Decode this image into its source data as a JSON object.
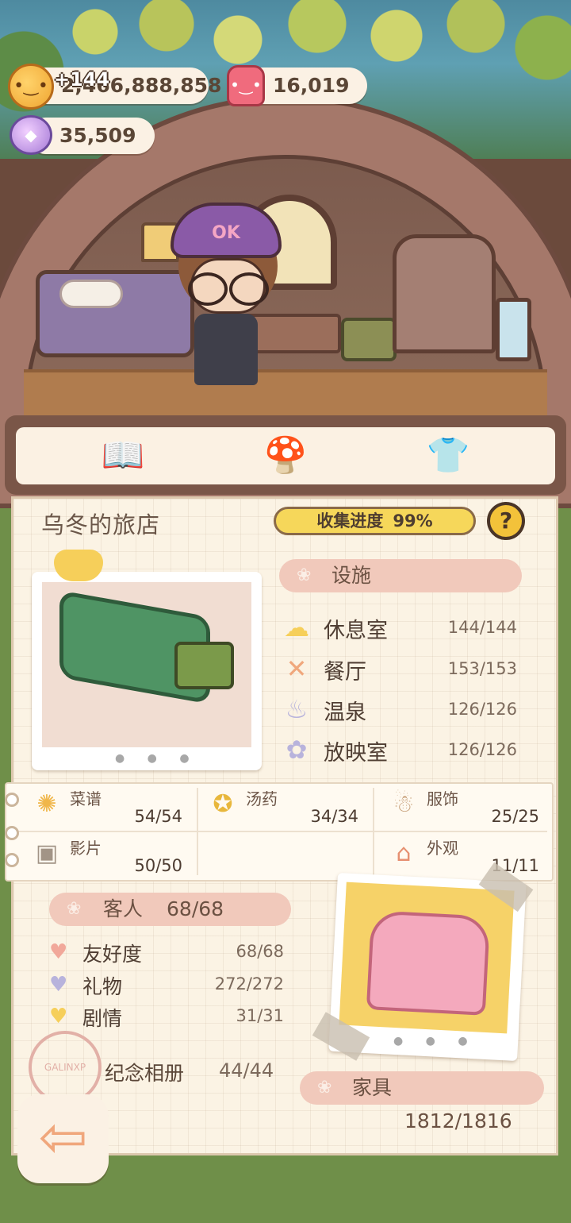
{
  "currency": {
    "coins": "2,466,888,858",
    "coin_bonus": "+144",
    "jelly": "16,019",
    "gems": "35,509"
  },
  "scene": {
    "hat_text": "OK"
  },
  "tabs": [
    {
      "name": "book",
      "icon": "open-book-icon",
      "active": true
    },
    {
      "name": "hotel",
      "icon": "hotel-icon",
      "active": false
    },
    {
      "name": "outfit",
      "icon": "shirt-icon",
      "active": false
    }
  ],
  "panel": {
    "title": "乌冬的旅店",
    "progress_label": "收集进度",
    "progress_value": "99%",
    "help": "?"
  },
  "facilities": {
    "heading": "设施",
    "items": [
      {
        "label": "休息室",
        "value": "144/144",
        "icon": "cloud-icon",
        "color": "#f6cf5a"
      },
      {
        "label": "餐厅",
        "value": "153/153",
        "icon": "fork-knife-icon",
        "color": "#f0a77c"
      },
      {
        "label": "温泉",
        "value": "126/126",
        "icon": "hot-spring-icon",
        "color": "#b8b3dc"
      },
      {
        "label": "放映室",
        "value": "126/126",
        "icon": "film-reel-icon",
        "color": "#b8b3dc"
      }
    ]
  },
  "categories": [
    {
      "label": "菜谱",
      "value": "54/54",
      "icon": "cake-icon"
    },
    {
      "label": "汤药",
      "value": "34/34",
      "icon": "potion-jar-icon"
    },
    {
      "label": "服饰",
      "value": "25/25",
      "icon": "bear-outfit-icon"
    },
    {
      "label": "影片",
      "value": "50/50",
      "icon": "film-clapper-icon"
    },
    {
      "label": "外观",
      "value": "11/11",
      "icon": "mushroom-house-icon"
    }
  ],
  "guests": {
    "heading": "客人",
    "count": "68/68",
    "items": [
      {
        "label": "友好度",
        "value": "68/68",
        "icon": "heart-icon",
        "color": "#f1a89a"
      },
      {
        "label": "礼物",
        "value": "272/272",
        "icon": "heart-icon",
        "color": "#b8b3dc"
      },
      {
        "label": "剧情",
        "value": "31/31",
        "icon": "heart-icon",
        "color": "#f6cf5a"
      }
    ]
  },
  "album": {
    "label": "纪念相册",
    "count": "44/44",
    "stamp_text": "GALINXP"
  },
  "furniture": {
    "heading": "家具",
    "count": "1812/1816"
  },
  "colors": {
    "accent_yellow": "#f6d75a",
    "tag_pink": "#f1c9bb",
    "paper": "#fbf3e4",
    "frame_brown": "#7a5648"
  }
}
